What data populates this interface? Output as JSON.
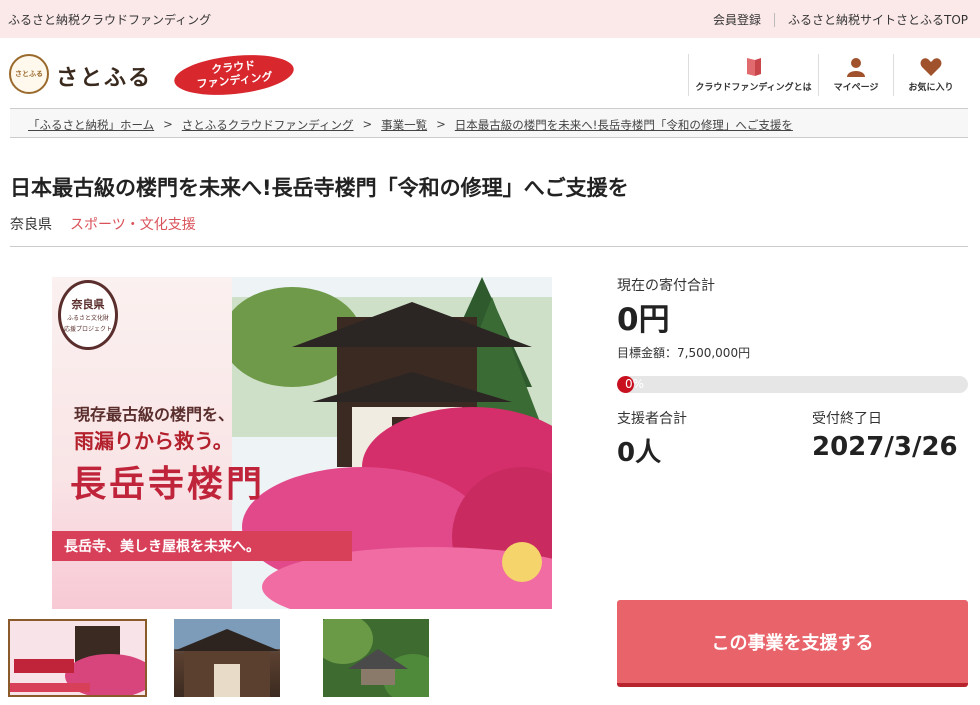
{
  "topbar": {
    "left_text": "ふるさと納税クラウドファンディング",
    "links": [
      "会員登録",
      "ふるさと納税サイトさとふるTOP"
    ]
  },
  "header": {
    "logo_mark": "さとふる",
    "logo_text": "さとふる",
    "badge_line1": "クラウド",
    "badge_line2": "ファンディング",
    "nav": [
      {
        "label": "クラウドファンディングとは",
        "icon": "book-icon"
      },
      {
        "label": "マイページ",
        "icon": "user-icon"
      },
      {
        "label": "お気に入り",
        "icon": "heart-icon"
      }
    ],
    "accent": "#d9272e",
    "nav_icon_color": "#a0522d"
  },
  "breadcrumb": [
    "「ふるさと納税」ホーム",
    "さとふるクラウドファンディング",
    "事業一覧",
    "日本最古級の楼門を未来へ!長岳寺楼門「令和の修理」へご支援を"
  ],
  "breadcrumb_sep": ">",
  "project": {
    "title": "日本最古級の楼門を未来へ!長岳寺楼門「令和の修理」へご支援を",
    "region": "奈良県",
    "category": "スポーツ・文化支援"
  },
  "hero": {
    "seal_title": "奈良県",
    "seal_sub1": "ふるさと文化財",
    "seal_sub2": "応援プロジェクト",
    "copy1": "現存最古級の楼門を、",
    "copy2": "雨漏りから救う。",
    "copy3": "長岳寺楼門",
    "band": "長岳寺、美しき屋根を未来へ。"
  },
  "stats": {
    "total_label": "現在の寄付合計",
    "total_value": "0円",
    "goal_text": "目標金額：7,500,000円",
    "progress_text": "0%",
    "progress_fraction": 0,
    "supporters_label": "支援者合計",
    "supporters_value": "0人",
    "deadline_label": "受付終了日",
    "deadline_value": "2027/3/26"
  },
  "cta": {
    "label": "この事業を支援する",
    "color": "#e8636a"
  }
}
